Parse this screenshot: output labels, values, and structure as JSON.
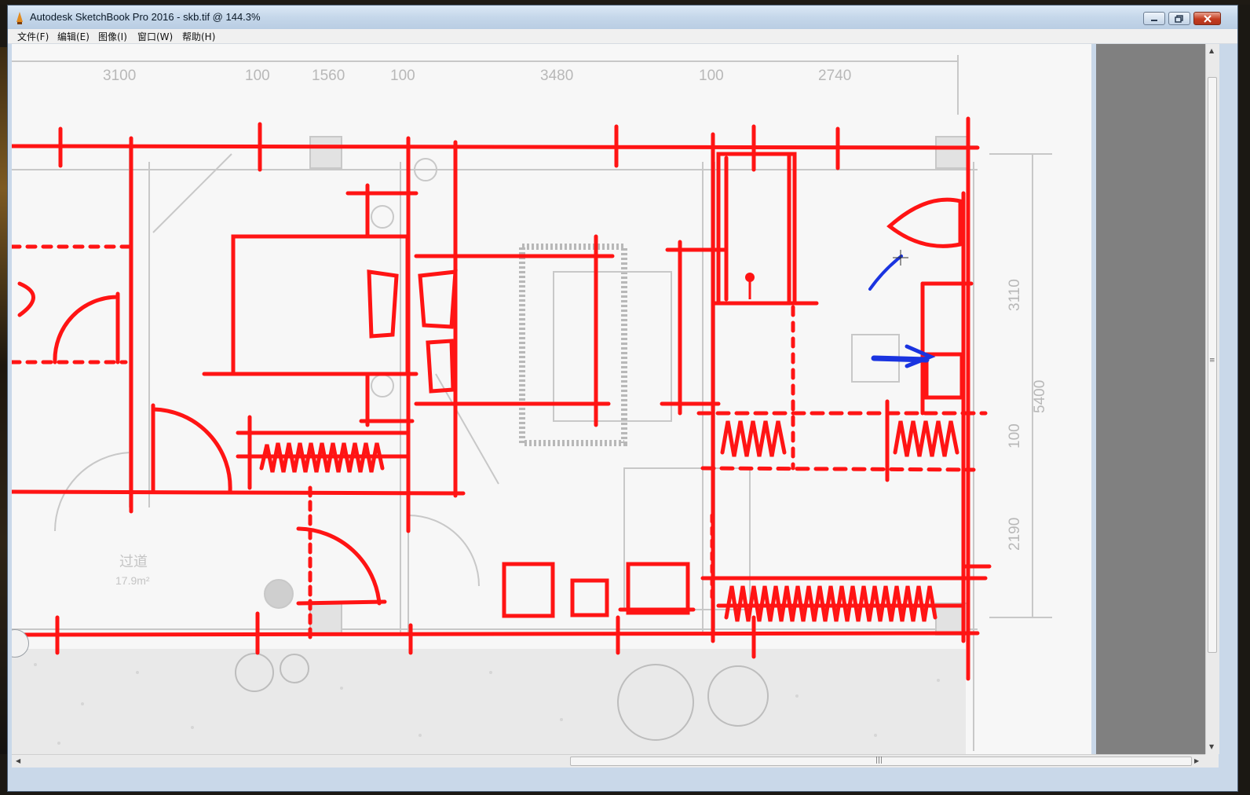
{
  "window": {
    "title": "Autodesk SketchBook Pro 2016 - skb.tif @ 144.3%",
    "controls": {
      "minimize": "minimize",
      "maximize": "maximize",
      "close": "close"
    }
  },
  "menu": [
    {
      "label": "文件(F)"
    },
    {
      "label": "编辑(E)"
    },
    {
      "label": "图像(I)"
    },
    {
      "label": "窗口(W)"
    },
    {
      "label": "帮助(H)"
    }
  ],
  "plan": {
    "dims_top": [
      "3100",
      "100",
      "1560",
      "100",
      "3480",
      "100",
      "2740"
    ],
    "dims_right": [
      "3110",
      "5400",
      "100",
      "2190"
    ],
    "room_label": "过道",
    "room_area": "17.9m²"
  },
  "colors": {
    "markup_red": "#ff1414",
    "markup_blue": "#1a34e0",
    "plan_gray": "#c8c8c8",
    "canvas_bg": "#f7f7f7",
    "gutter": "#808080"
  },
  "scroll": {
    "vertical_grip": "≡",
    "horizontal_grip": "|||"
  }
}
